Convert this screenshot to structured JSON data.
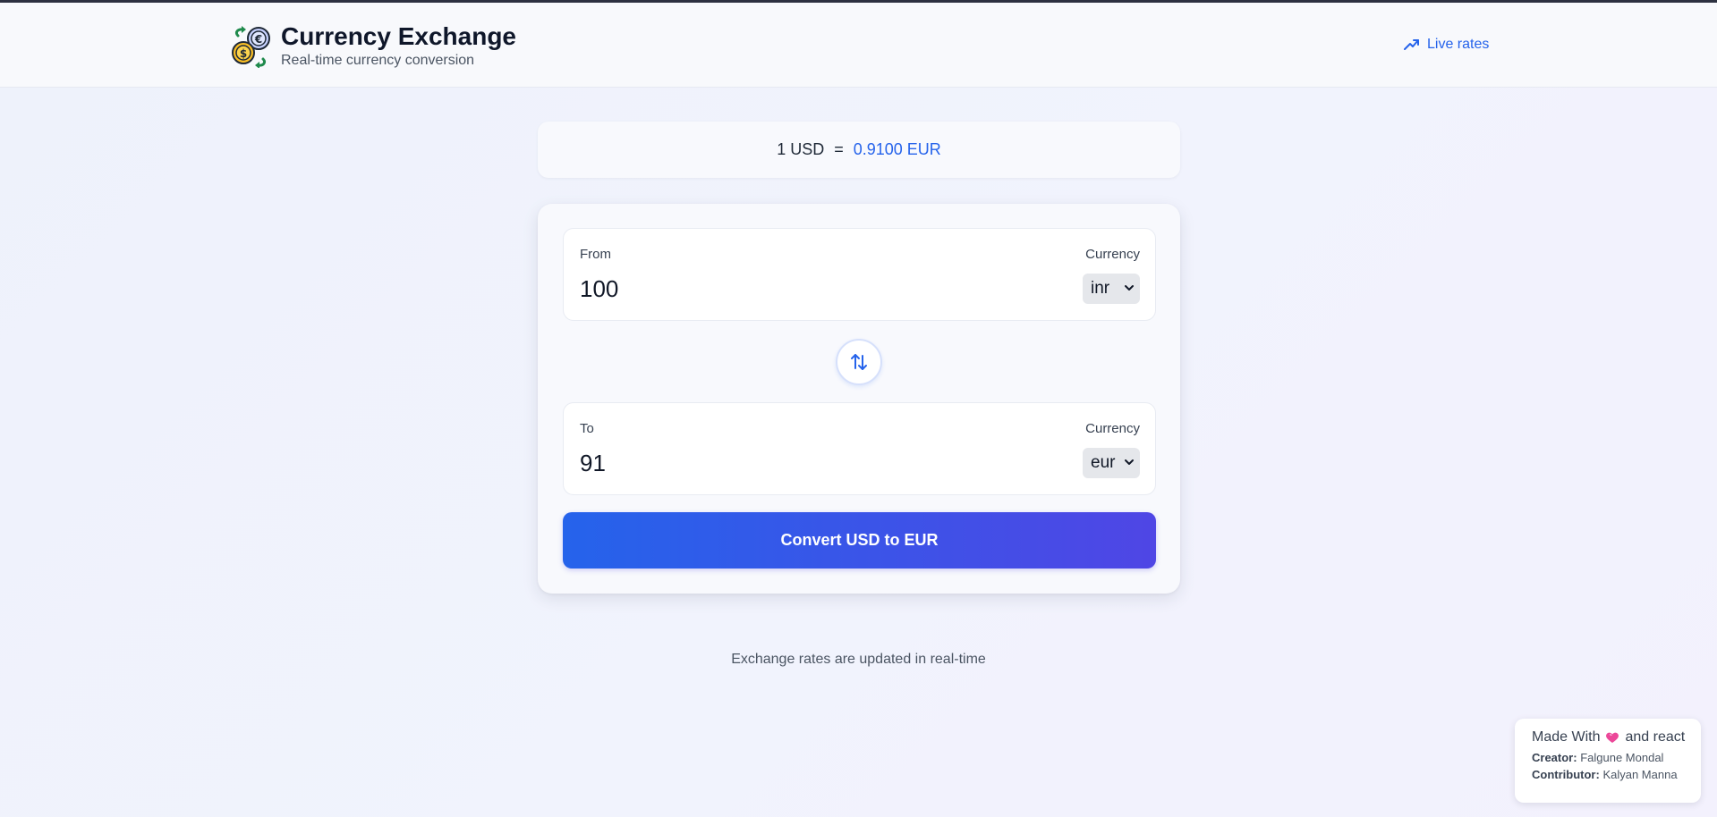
{
  "header": {
    "title": "Currency Exchange",
    "subtitle": "Real-time currency conversion",
    "live_rates_label": "Live rates"
  },
  "rate": {
    "base": "1 USD",
    "equals": "=",
    "target": "0.9100 EUR"
  },
  "converter": {
    "from": {
      "label": "From",
      "value": "100",
      "currency_label": "Currency",
      "currency": "inr"
    },
    "to": {
      "label": "To",
      "value": "91",
      "currency_label": "Currency",
      "currency": "eur"
    },
    "convert_label": "Convert USD to EUR"
  },
  "footer": {
    "note": "Exchange rates are updated in real-time"
  },
  "credits": {
    "made_with_prefix": "Made With",
    "made_with_suffix": "and react",
    "creator_label": "Creator:",
    "creator_name": "Falgune Mondal",
    "contributor_label": "Contributor:",
    "contributor_name": "Kalyan Manna"
  },
  "colors": {
    "accent": "#2563eb",
    "button_gradient_end": "#4f46e5",
    "heart": "#ec4899"
  }
}
